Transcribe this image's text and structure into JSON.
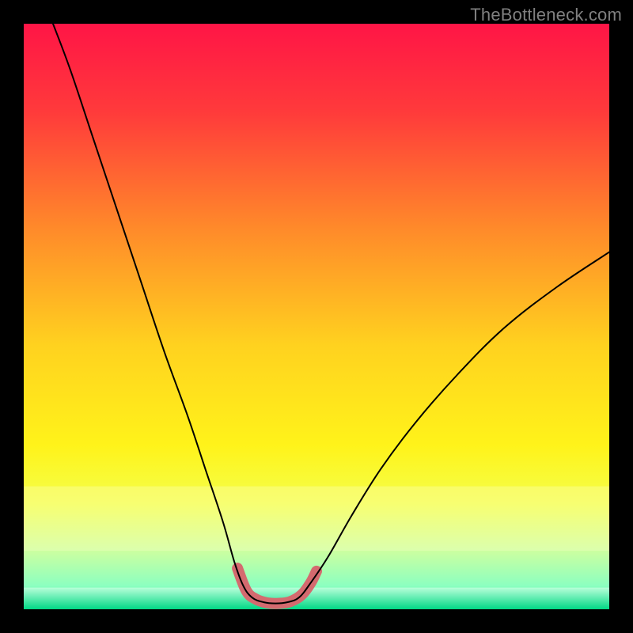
{
  "watermark": "TheBottleneck.com",
  "chart_data": {
    "type": "line",
    "title": "",
    "xlabel": "",
    "ylabel": "",
    "xlim": [
      0,
      100
    ],
    "ylim": [
      0,
      100
    ],
    "gradient_stops": [
      {
        "offset": 0.0,
        "color": "#ff1546"
      },
      {
        "offset": 0.15,
        "color": "#ff3a3b"
      },
      {
        "offset": 0.35,
        "color": "#ff8a2a"
      },
      {
        "offset": 0.55,
        "color": "#ffd21f"
      },
      {
        "offset": 0.72,
        "color": "#fff31a"
      },
      {
        "offset": 0.82,
        "color": "#f4ff4a"
      },
      {
        "offset": 0.9,
        "color": "#ccffa0"
      },
      {
        "offset": 0.96,
        "color": "#8cffc0"
      },
      {
        "offset": 1.0,
        "color": "#00e18a"
      }
    ],
    "series": [
      {
        "name": "main-curve",
        "color": "#000000",
        "stroke_width": 2,
        "points_xy": [
          [
            5.0,
            100.0
          ],
          [
            8.0,
            92.0
          ],
          [
            12.0,
            80.0
          ],
          [
            16.0,
            68.0
          ],
          [
            20.0,
            56.0
          ],
          [
            24.0,
            44.0
          ],
          [
            28.0,
            33.0
          ],
          [
            31.0,
            24.0
          ],
          [
            34.0,
            15.0
          ],
          [
            36.0,
            8.0
          ],
          [
            37.5,
            4.0
          ],
          [
            39.0,
            2.0
          ],
          [
            41.0,
            1.2
          ],
          [
            43.0,
            1.0
          ],
          [
            45.0,
            1.2
          ],
          [
            47.0,
            2.0
          ],
          [
            49.0,
            4.5
          ],
          [
            52.0,
            9.0
          ],
          [
            56.0,
            16.0
          ],
          [
            61.0,
            24.0
          ],
          [
            67.0,
            32.0
          ],
          [
            74.0,
            40.0
          ],
          [
            82.0,
            48.0
          ],
          [
            91.0,
            55.0
          ],
          [
            100.0,
            61.0
          ]
        ]
      },
      {
        "name": "highlight-arc",
        "color": "#d46a6f",
        "stroke_width": 14,
        "linecap": "round",
        "points_xy": [
          [
            36.5,
            7.0
          ],
          [
            38.0,
            3.2
          ],
          [
            39.5,
            1.8
          ],
          [
            41.5,
            1.1
          ],
          [
            43.5,
            1.0
          ],
          [
            45.5,
            1.3
          ],
          [
            47.5,
            2.5
          ],
          [
            49.0,
            4.5
          ],
          [
            50.0,
            6.5
          ]
        ]
      }
    ],
    "bottom_band": {
      "y_fraction_start": 0.963,
      "y_fraction_end": 1.0,
      "color_top": "#b8ffd9",
      "color_bottom": "#00d885"
    },
    "pale_band": {
      "y_fraction_start": 0.79,
      "y_fraction_end": 0.9,
      "color": "#ffffcc",
      "opacity": 0.3
    }
  }
}
